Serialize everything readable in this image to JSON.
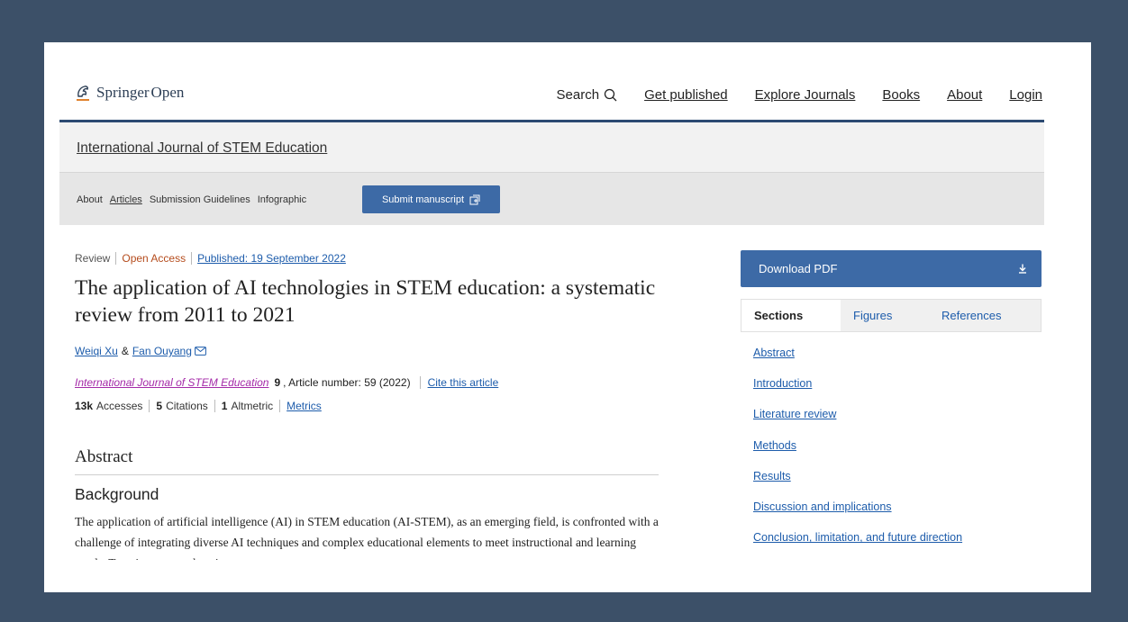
{
  "brand": {
    "name": "Springer",
    "suffix": "Open"
  },
  "topnav": {
    "search_label": "Search",
    "links": [
      "Get published",
      "Explore Journals",
      "Books",
      "About",
      "Login"
    ]
  },
  "journal": {
    "name": "International Journal of STEM Education"
  },
  "subnav": {
    "items": [
      "About",
      "Articles",
      "Submission Guidelines",
      "Infographic"
    ],
    "submit_label": "Submit manuscript"
  },
  "article": {
    "type": "Review",
    "access": "Open Access",
    "published": "Published: 19 September 2022",
    "title": "The application of AI technologies in STEM education: a systematic review from 2011 to 2021",
    "authors": [
      "Weiqi Xu",
      "Fan Ouyang"
    ],
    "author_sep": "&",
    "citation": {
      "journal": "International Journal of STEM Education",
      "volume": "9",
      "rest": ", Article number: 59 (2022)",
      "cite_label": "Cite this article"
    },
    "metrics": {
      "accesses_num": "13k",
      "accesses_label": "Accesses",
      "citations_num": "5",
      "citations_label": "Citations",
      "altmetric_num": "1",
      "altmetric_label": "Altmetric",
      "metrics_link": "Metrics"
    },
    "abstract_heading": "Abstract",
    "background_heading": "Background",
    "abstract_text": "The application of artificial intelligence (AI) in STEM education (AI-STEM), as an emerging field, is confronted with a challenge of integrating diverse AI techniques and complex educational elements to meet instructional and learning needs. To gain a comprehensive"
  },
  "sidebar": {
    "download_label": "Download PDF",
    "tabs": [
      "Sections",
      "Figures",
      "References"
    ],
    "sections": [
      "Abstract",
      "Introduction",
      "Literature review",
      "Methods",
      "Results",
      "Discussion and implications",
      "Conclusion, limitation, and future direction"
    ]
  },
  "colors": {
    "background": "#3c5068",
    "accent": "#3d6aa6",
    "nav_rule": "#2c4a72",
    "open_access": "#b54c1d",
    "journal_link": "#a42aa8"
  }
}
